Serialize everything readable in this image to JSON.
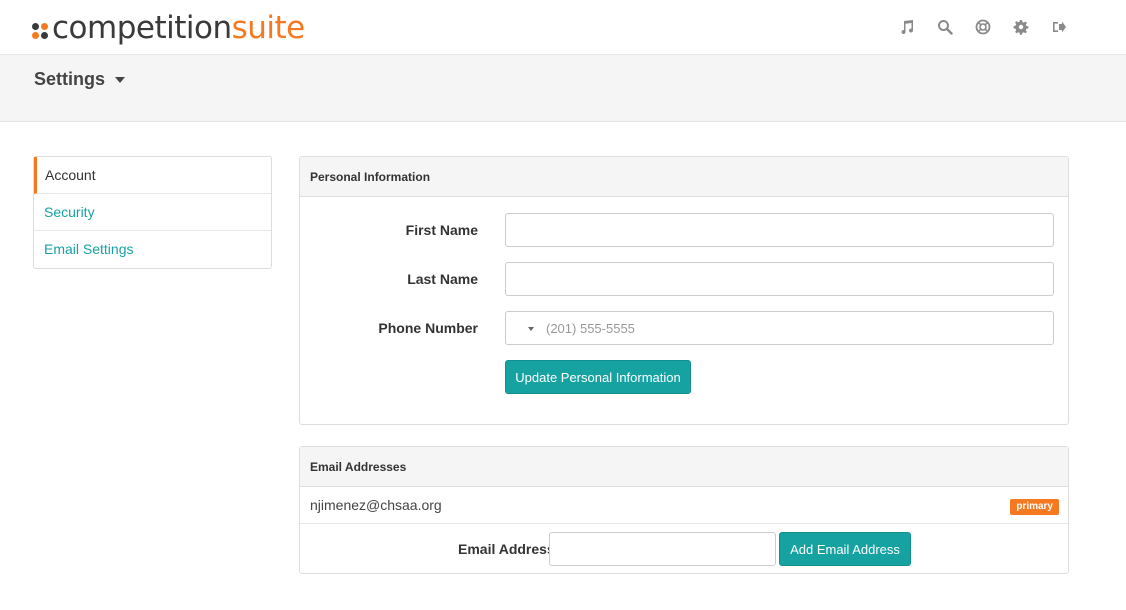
{
  "header": {
    "logo_part1": "competition",
    "logo_part2": "suite",
    "icons": [
      "music-icon",
      "search-icon",
      "help-lifebuoy-icon",
      "gear-icon",
      "logout-icon"
    ]
  },
  "subheader": {
    "title": "Settings"
  },
  "sidebar": {
    "items": [
      {
        "label": "Account",
        "active": true
      },
      {
        "label": "Security",
        "active": false
      },
      {
        "label": "Email Settings",
        "active": false
      }
    ]
  },
  "personal_info": {
    "heading": "Personal Information",
    "first_name_label": "First Name",
    "first_name_value": "",
    "last_name_label": "Last Name",
    "last_name_value": "",
    "phone_label": "Phone Number",
    "phone_placeholder": "(201) 555-5555",
    "update_button": "Update Personal Information"
  },
  "email_addresses": {
    "heading": "Email Addresses",
    "emails": [
      {
        "address": "njimenez@chsaa.org",
        "badge": "primary"
      }
    ],
    "add_label": "Email Address",
    "add_value": "",
    "add_button": "Add Email Address"
  },
  "colors": {
    "accent_orange": "#f47920",
    "accent_teal": "#17a2a2",
    "logo_dark": "#3a3a3a"
  }
}
